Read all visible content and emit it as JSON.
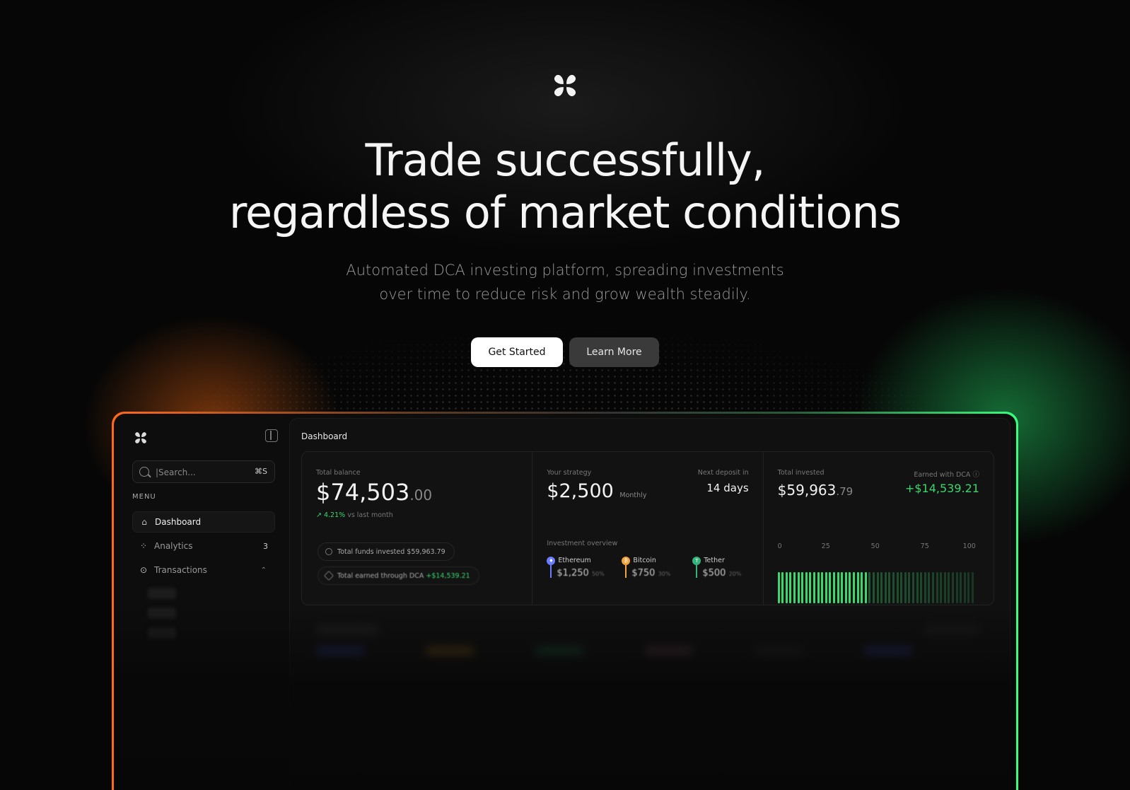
{
  "hero": {
    "title_line1": "Trade successfully,",
    "title_line2": "regardless of market conditions",
    "subtitle_line1": "Automated DCA investing platform, spreading investments",
    "subtitle_line2": "over time to reduce risk and grow wealth steadily.",
    "primary_button": "Get Started",
    "secondary_button": "Learn More"
  },
  "sidebar": {
    "search_placeholder": "|Search...",
    "search_shortcut": "⌘S",
    "menu_label": "MENU",
    "items": [
      {
        "label": "Dashboard",
        "icon": "home-icon",
        "active": true
      },
      {
        "label": "Analytics",
        "icon": "analytics-icon",
        "badge": "3"
      },
      {
        "label": "Transactions",
        "icon": "transactions-icon",
        "expanded": true
      }
    ]
  },
  "dashboard": {
    "title": "Dashboard",
    "balance": {
      "label": "Total balance",
      "value": "$74,503",
      "cents": ".00",
      "change": "↗ 4.21%",
      "change_note": "vs last month",
      "funds_invested": "Total funds invested $59,963.79",
      "earned_label": "Total earned through DCA",
      "earned_value": "+$14,539.21"
    },
    "strategy": {
      "label": "Your strategy",
      "value": "$2,500",
      "period": "Monthly",
      "next_label": "Next deposit in",
      "next_value": "14 days",
      "overview_label": "Investment overview",
      "coins": [
        {
          "name": "Ethereum",
          "value": "$1,250",
          "pct": "50%",
          "color": "#6a7cff",
          "glyph": "♦"
        },
        {
          "name": "Bitcoin",
          "value": "$750",
          "pct": "30%",
          "color": "#f2a33a",
          "glyph": "₿"
        },
        {
          "name": "Tether",
          "value": "$500",
          "pct": "20%",
          "color": "#33b47a",
          "glyph": "T"
        }
      ]
    },
    "invested": {
      "label": "Total invested",
      "value": "$59,963",
      "cents": ".79",
      "earned_label": "Earned with DCA",
      "earned_value": "+$14,539.21",
      "scale": [
        "0",
        "25",
        "50",
        "75",
        "100"
      ],
      "progress_fraction": 0.45
    }
  },
  "colors": {
    "accent_orange": "#ff6a1a",
    "accent_green": "#39ff80",
    "positive": "#3bd66e"
  }
}
